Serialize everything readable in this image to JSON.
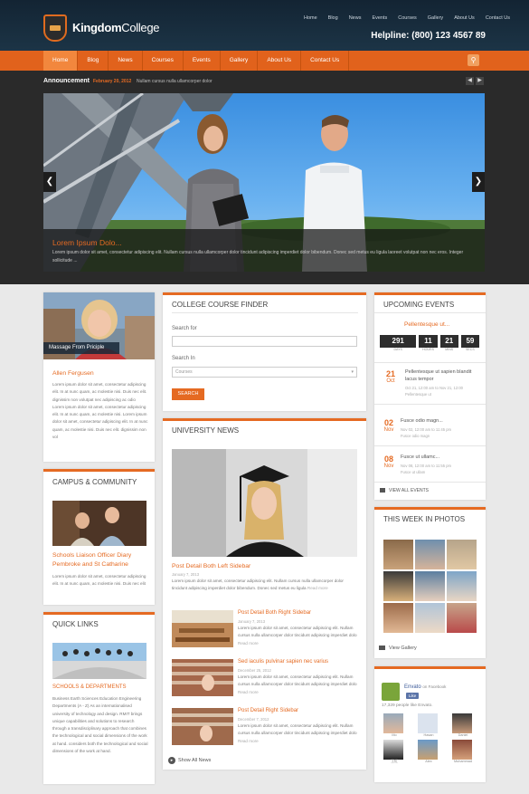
{
  "header": {
    "logo_bold": "Kingdom",
    "logo_light": "College",
    "top_nav": [
      "Home",
      "Blog",
      "News",
      "Events",
      "Courses",
      "Gallery",
      "About Us",
      "Contact Us"
    ],
    "helpline": "Helpline: (800) 123 4567 89"
  },
  "main_nav": {
    "items": [
      "Home",
      "Blog",
      "News",
      "Courses",
      "Events",
      "Gallery",
      "About Us",
      "Contact Us"
    ],
    "active": "Home"
  },
  "announcement": {
    "label": "Announcement",
    "date": "February 20, 2012",
    "text": "Nullam cursus nulla ullamcorper dolor"
  },
  "slider": {
    "caption_title": "Lorem Ipsum Dolo...",
    "caption_text": "Lorem ipsum dolor sit amet, consectetur adipiscing elit. Nullam cursus nulla ullamcorper dolor tincidunt adipiscing imperdiet dolor bibendum. Donec sed metus eu ligula laoreet volutpat non nec eros. Integer sollicitude ..."
  },
  "principal": {
    "photo_label": "Massage From Priciple",
    "name": "Allen Fergusen",
    "text": "Lorem ipsum dolor sit amet, consectetur adipiscing elit. In at nunc quam, ac molestie nisi. Duis nec elit. dignissim non volutpat nec adipiscing ac odio Lorem ipsum dolor sit amet, consectetur adipiscing elit. In at nunc quam, ac molestie nisi. Lorem ipsum dolor sit amet, consectetur adipiscing elit. In at nunc quam, ac molestie nisi. Duis nec elit. dignissim non vol"
  },
  "campus": {
    "title": "Campus & Community",
    "link": "Schools Liaison Officer Diary Pembroke and St Catharine",
    "text": "Lorem ipsum dolor sit amet, consectetur adipiscing elit. In at nunc quam, ac molestie nisi. Duis nec elit"
  },
  "quick_links": {
    "title": "Quick Links",
    "subtitle": "Schools & Departments",
    "text": "Business Earth Sciences Education Engineering Departments (A - Z) As an internationalised university of technology and design. RMIT brings unique capabilities and solutions to research through a transdisciplinary approach that combines the technological and social dimensions of the work at hand. considers both the technological and social dimensions of the work at hand."
  },
  "course_finder": {
    "title": "College Course Finder",
    "search_for_label": "Search for",
    "search_in_label": "Search In",
    "select_value": "Courses",
    "button": "Search"
  },
  "university_news": {
    "title": "University News",
    "featured": {
      "title": "Post Detail Both Left Sidebar",
      "date": "January 7, 2013",
      "text": "Lorem ipsum dolor sit amet, consectetur adipiscing elit. Nullam cursus nulla ullamcorper dolor tincidunt adipiscing imperdiet dolor bibendum. Donec sed metus eu ligula",
      "read_more": "Read more"
    },
    "items": [
      {
        "title": "Post Detail Both Right Sidebar",
        "date": "January 7, 2013",
        "text": "Lorem ipsum dolor sit amet, consectetur adipiscing elit. Nullam cursus nulla ullamcorper dolor tincidunt adipiscing imperdiet dolo",
        "read_more": "Read more"
      },
      {
        "title": "Sed iaculis pulvinar sapien nec varius",
        "date": "December 25, 2012",
        "text": "Lorem ipsum dolor sit amet, consectetur adipiscing elit. Nullam cursus nulla ullamcorper dolor tincidunt adipiscing imperdiet dolo",
        "read_more": "Read more"
      },
      {
        "title": "Post Detail Right Sidebar",
        "date": "December 7, 2012",
        "text": "Lorem ipsum dolor sit amet, consectetur adipiscing elit. Nullam cursus nulla ullamcorper dolor tincidunt adipiscing imperdiet dolo",
        "read_more": "Read more"
      }
    ],
    "show_all": "Show All News"
  },
  "events": {
    "title": "Upcoming Events",
    "featured_title": "Pellentesque ut...",
    "countdown": [
      {
        "value": "291",
        "unit": "DAYS"
      },
      {
        "value": "11",
        "unit": "HOURS"
      },
      {
        "value": "21",
        "unit": "MINS"
      },
      {
        "value": "59",
        "unit": "SECS"
      }
    ],
    "list": [
      {
        "day": "21",
        "month": "Oct",
        "title": "Pellentesque ut sapien blandit lacus tempor",
        "meta": "Oct 21, 12:00 am to Nov 21, 12:00",
        "place": "Pellentesque ut"
      },
      {
        "day": "02",
        "month": "Nov",
        "title": "Fusce odio magn...",
        "meta": "Nov 02, 12:00 am to 11:45 pm",
        "place": "Fusce odio magn"
      },
      {
        "day": "08",
        "month": "Nov",
        "title": "Fusce ut ullamc...",
        "meta": "Nov 08, 12:00 am to 11:55 pm",
        "place": "Fusce ut ullam"
      }
    ],
    "view_all": "View All Events"
  },
  "photos": {
    "title": "This Week In Photos",
    "view_gallery": "View Gallery"
  },
  "social": {
    "name": "Envato",
    "on_facebook": "on Facebook",
    "like": "Like",
    "count_text": "17,329 people like Envato.",
    "people": [
      "Mo",
      "Hasan",
      "Daniel",
      "王紅",
      "Alex",
      "Muhammad"
    ]
  },
  "colors": {
    "accent": "#e56a22",
    "header_bg": "#1b3245",
    "band_bg": "#2a2a2a"
  }
}
